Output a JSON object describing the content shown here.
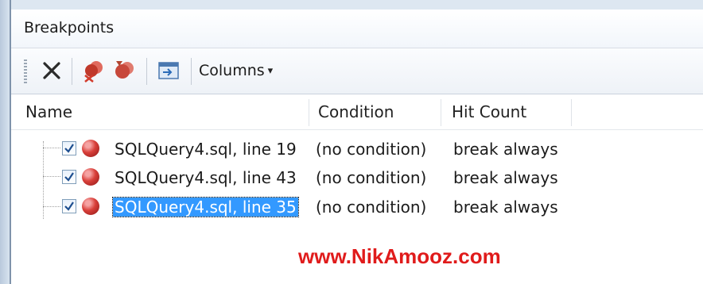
{
  "window": {
    "title": "Breakpoints"
  },
  "toolbar": {
    "buttons": [
      {
        "name": "delete",
        "icon": "close-icon"
      },
      {
        "name": "delete-all",
        "icon": "delete-all-breakpoints-icon"
      },
      {
        "name": "toggle-all",
        "icon": "disable-all-breakpoints-icon"
      },
      {
        "name": "export",
        "icon": "export-icon"
      }
    ],
    "columns_label": "Columns",
    "columns_arrow": "▾"
  },
  "table": {
    "columns": [
      "Name",
      "Condition",
      "Hit Count"
    ],
    "rows": [
      {
        "name": "SQLQuery4.sql, line 19",
        "condition": "(no condition)",
        "hit_count": "break always",
        "checked": true,
        "selected": false
      },
      {
        "name": "SQLQuery4.sql, line 43",
        "condition": "(no condition)",
        "hit_count": "break always",
        "checked": true,
        "selected": false
      },
      {
        "name": "SQLQuery4.sql, line 35",
        "condition": "(no condition)",
        "hit_count": "break always",
        "checked": true,
        "selected": true
      }
    ]
  },
  "watermark": "www.NikAmooz.com",
  "colors": {
    "selection": "#3399ff",
    "breakpoint": "#d9403a",
    "watermark": "#e01b1b"
  }
}
